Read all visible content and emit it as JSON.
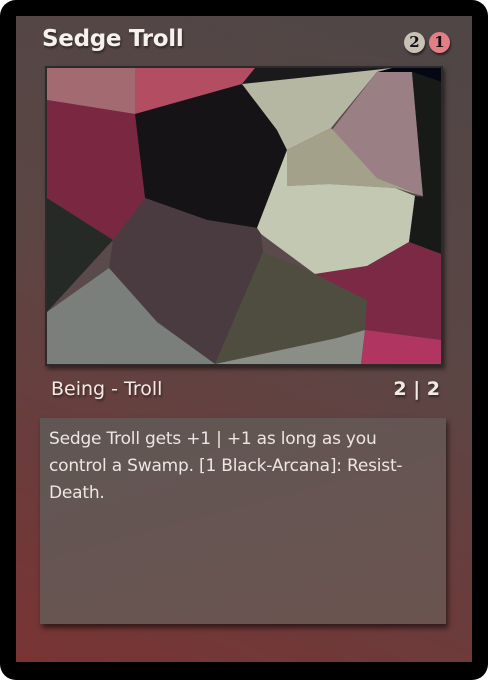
{
  "card": {
    "name": "Sedge Troll",
    "mana_cost": [
      {
        "symbol": "2",
        "kind": "generic",
        "color": "#c8c2b4"
      },
      {
        "symbol": "1",
        "kind": "red",
        "color": "#e37e86"
      }
    ],
    "type_line": "Being - Troll",
    "power_toughness": "2 | 2",
    "rules_text": "Sedge Troll gets +1 | +1 as long as you control a Swamp. [1 Black-Arcana]: Resist-Death.",
    "colors": {
      "border": "#000000",
      "frame_top": "#4f4646",
      "frame_bottom": "#7a3434",
      "text_box": "#665552",
      "text": "#f1ebe6"
    }
  }
}
